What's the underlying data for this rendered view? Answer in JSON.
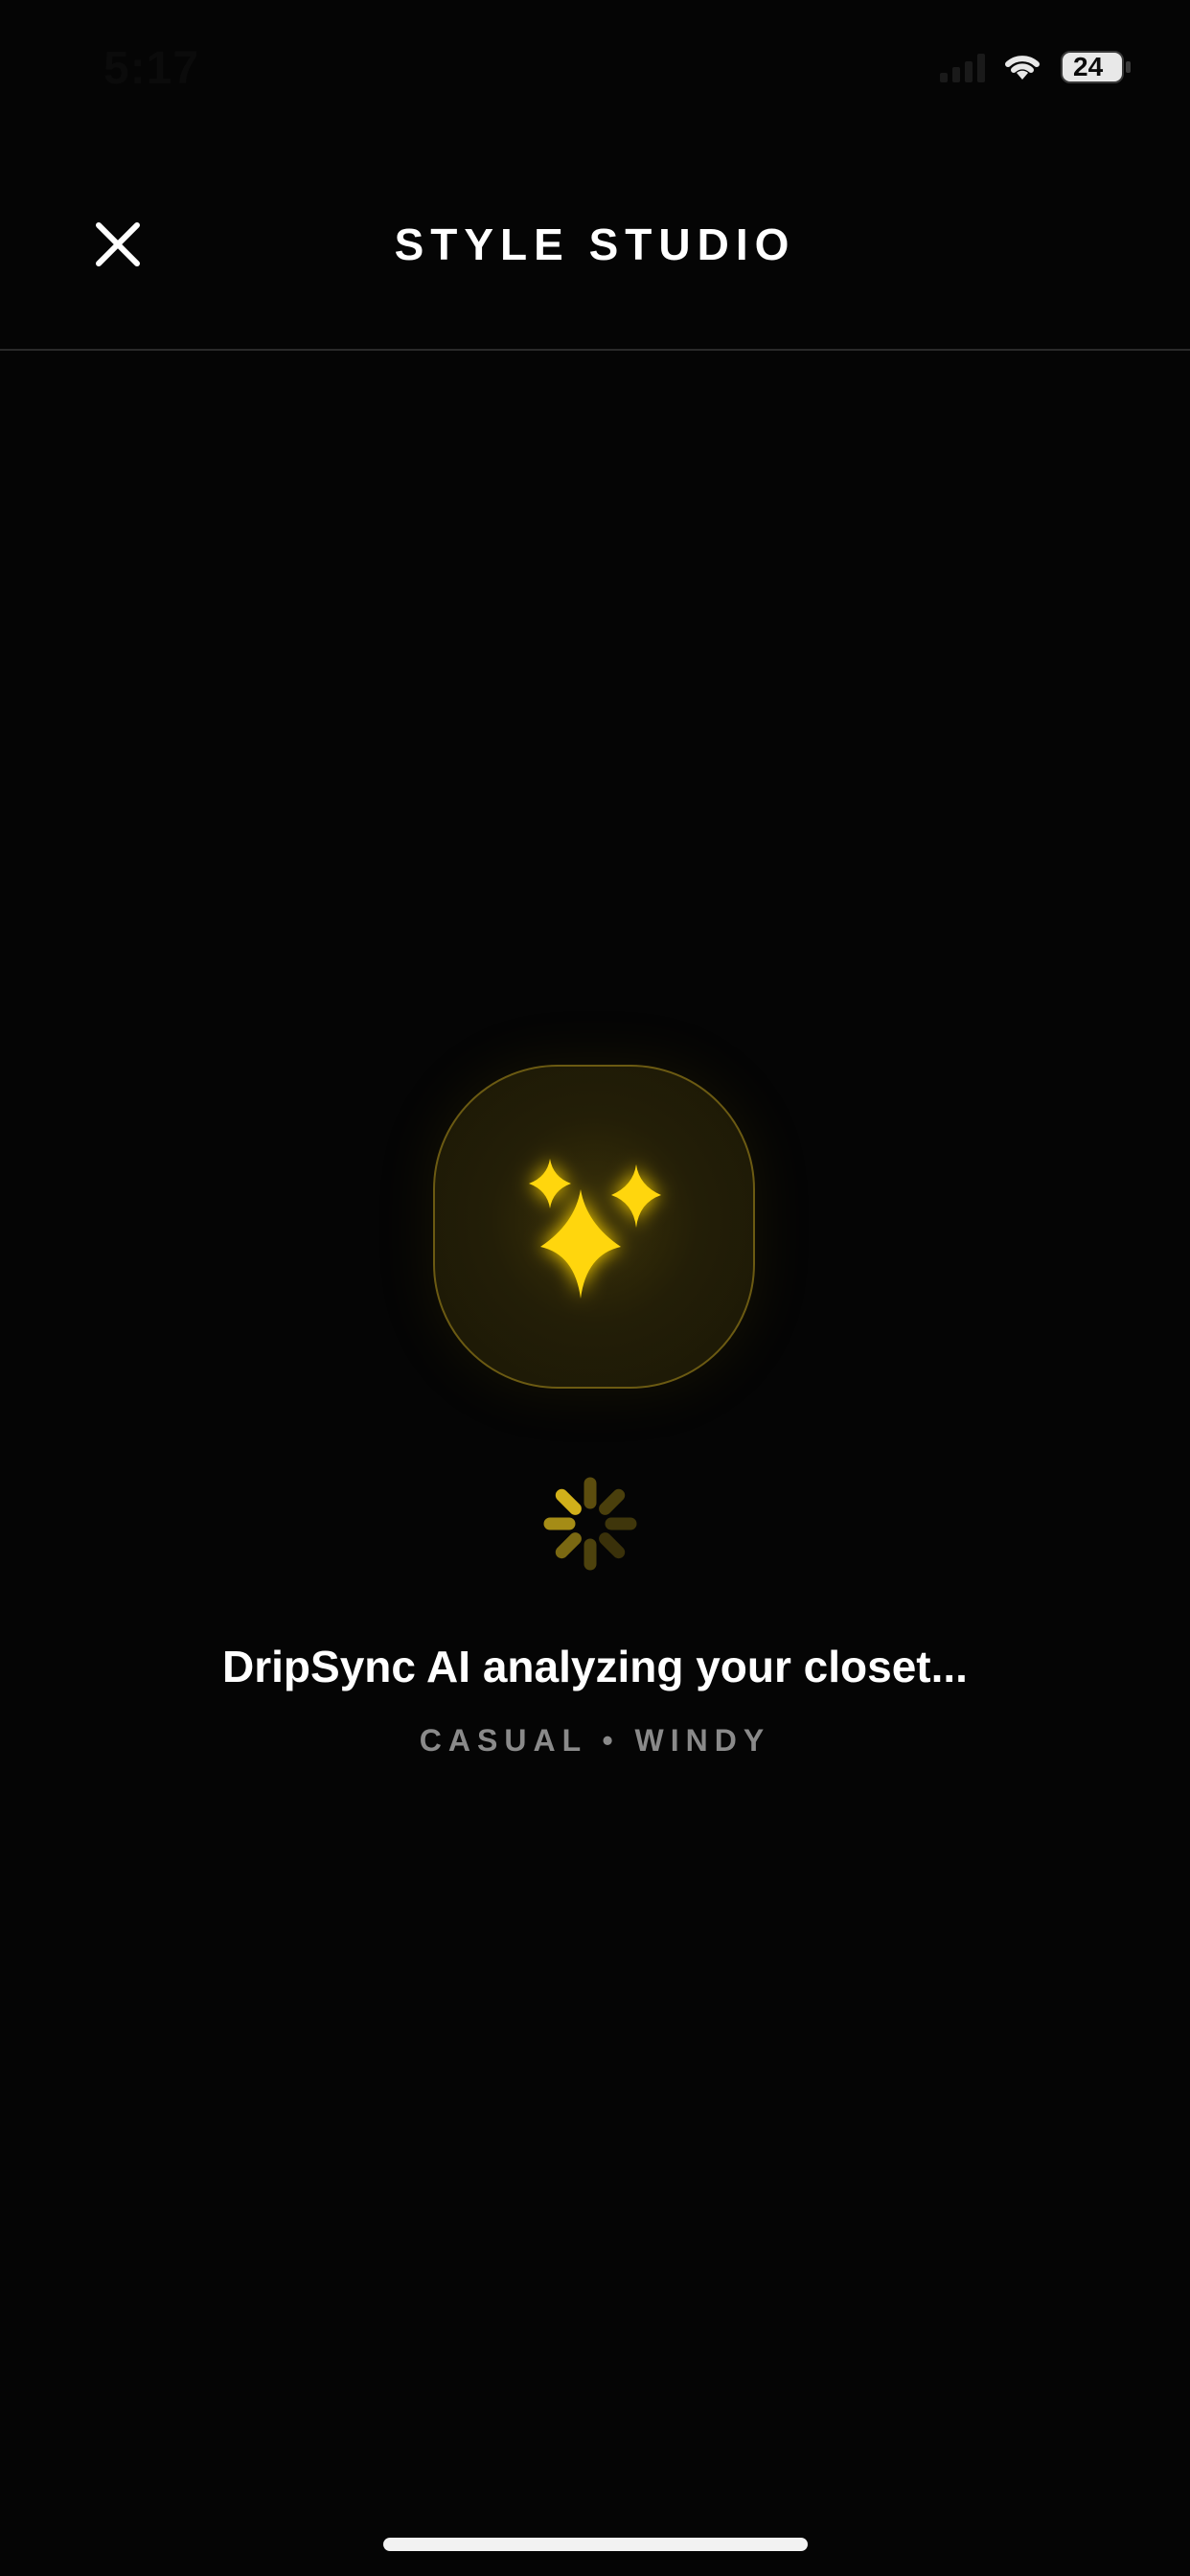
{
  "status_bar": {
    "time": "5:17",
    "battery": "24"
  },
  "nav": {
    "title": "STYLE STUDIO",
    "close_icon": "close-icon"
  },
  "loading": {
    "hero_icon": "sparkles-icon",
    "spinner_icon": "activity-spinner-icon",
    "message": "DripSync AI analyzing your closet...",
    "context": "CASUAL • WINDY"
  },
  "colors": {
    "background": "#050505",
    "accent": "#FFD60A",
    "muted_text": "#8A8A8A",
    "divider": "#2A2A2A"
  }
}
